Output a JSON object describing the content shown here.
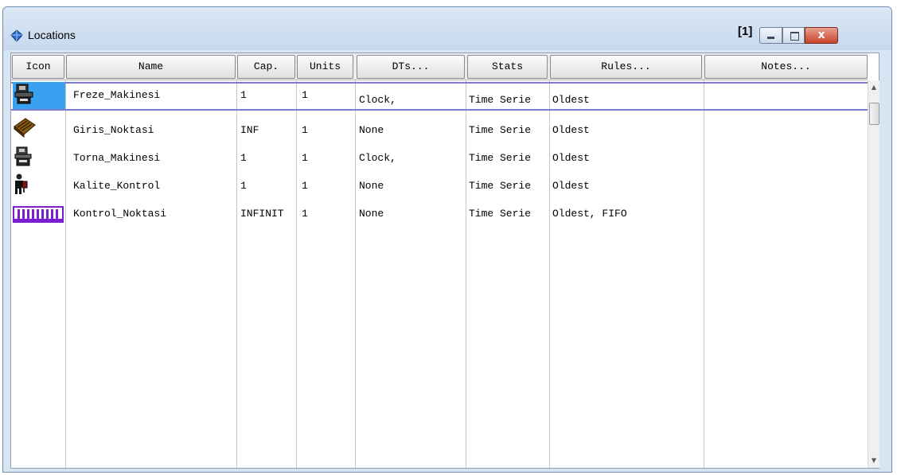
{
  "window": {
    "title": "Locations",
    "index_label": "[1]",
    "close_symbol": "x"
  },
  "columns": [
    "Icon",
    "Name",
    "Cap.",
    "Units",
    "DTs...",
    "Stats",
    "Rules...",
    "Notes..."
  ],
  "rows": [
    {
      "name": "Freze_Makinesi",
      "cap": "1",
      "units": "1",
      "dts": "Clock,",
      "stats": "Time Serie",
      "rules": "Oldest",
      "notes": "",
      "icon": "milling-machine-icon"
    },
    {
      "name": "Giris_Noktasi",
      "cap": "INF",
      "units": "1",
      "dts": "None",
      "stats": "Time Serie",
      "rules": "Oldest",
      "notes": "",
      "icon": "pallet-icon"
    },
    {
      "name": "Torna_Makinesi",
      "cap": "1",
      "units": "1",
      "dts": "Clock,",
      "stats": "Time Serie",
      "rules": "Oldest",
      "notes": "",
      "icon": "lathe-machine-icon"
    },
    {
      "name": "Kalite_Kontrol",
      "cap": "1",
      "units": "1",
      "dts": "None",
      "stats": "Time Serie",
      "rules": "Oldest",
      "notes": "",
      "icon": "worker-icon"
    },
    {
      "name": "Kontrol_Noktasi",
      "cap": "INFINIT",
      "units": "1",
      "dts": "None",
      "stats": "Time Serie",
      "rules": "Oldest, FIFO",
      "notes": "",
      "icon": "conveyor-icon"
    }
  ],
  "colors": {
    "selection_icon_bg": "#3aa0f0",
    "selection_border": "#7b7bd0",
    "conveyor": "#7a1fd0"
  }
}
